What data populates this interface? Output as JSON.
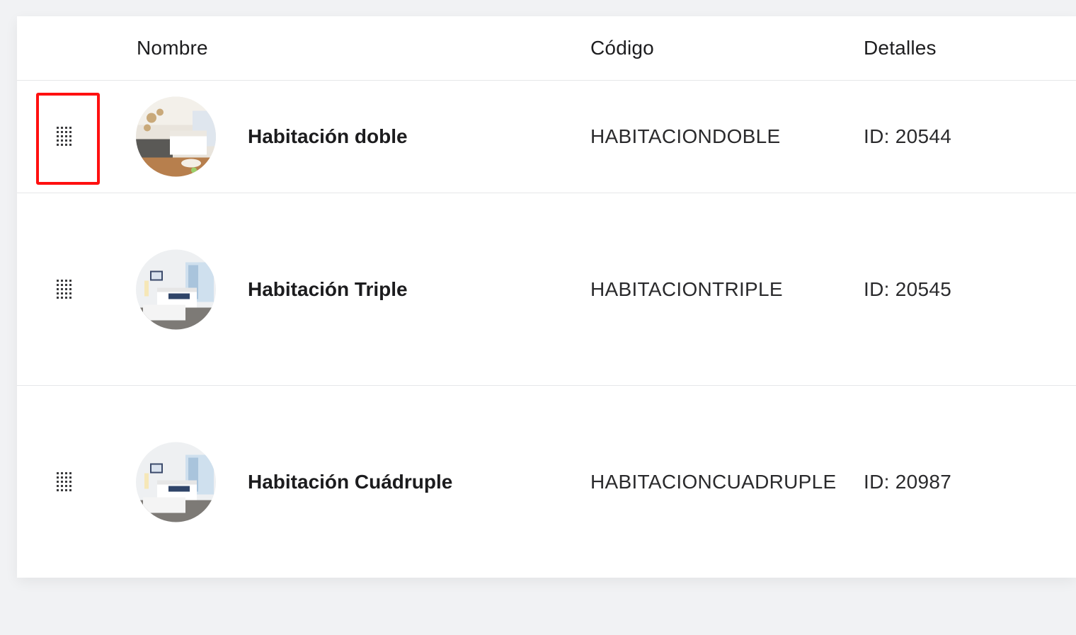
{
  "table": {
    "columns": {
      "name": "Nombre",
      "code": "Código",
      "details": "Detalles"
    },
    "rows": [
      {
        "name": "Habitación doble",
        "code": "HABITACIONDOBLE",
        "details": "ID: 20544",
        "thumbnail": "room-photo-icon",
        "selected_handle": true
      },
      {
        "name": "Habitación Triple",
        "code": "HABITACIONTRIPLE",
        "details": "ID: 20545",
        "thumbnail": "room-photo-icon",
        "selected_handle": false
      },
      {
        "name": "Habitación Cuádruple",
        "code": "HABITACIONCUADRUPLE",
        "details": "ID: 20987",
        "thumbnail": "room-photo-icon",
        "selected_handle": false
      }
    ]
  },
  "colors": {
    "highlight": "#ff1010",
    "background": "#f1f2f4",
    "card": "#ffffff"
  }
}
